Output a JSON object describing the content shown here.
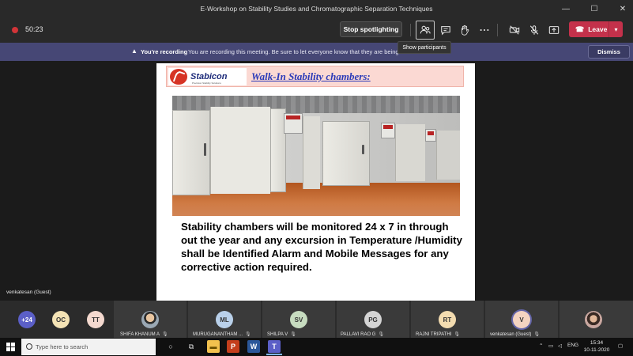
{
  "window": {
    "title": "E-Workshop on Stability Studies and Chromatographic Separation Techniques",
    "controls": [
      "—",
      "☐",
      "✕"
    ]
  },
  "toolbar": {
    "timer": "50:23",
    "spotlight_label": "Stop spotlighting",
    "leave_label": "Leave",
    "tooltip": "Show participants",
    "icons": [
      "participants-icon",
      "chat-icon",
      "raise-hand-icon",
      "more-icon",
      "camera-off-icon",
      "mic-off-icon",
      "share-icon"
    ]
  },
  "banner": {
    "title": "You're recording",
    "message": "You are recording this meeting. Be sure to let everyone know that they are being re",
    "dismiss_label": "Dismiss"
  },
  "slide": {
    "logo_text": "Stabicon",
    "logo_sub": "Precision Stability Solutions",
    "title": "Walk-In Stability chambers:",
    "body": "Stability chambers will be monitored 24 x 7 in through out the year and any excursion in Temperature /Humidity shall be Identified Alarm and Mobile Messages for any corrective action required."
  },
  "presenter_name": "venkatesan (Guest)",
  "participants": [
    {
      "initials": "+24",
      "color": "#5b5fc7",
      "text_color": "#ffffff"
    },
    {
      "initials": "OC",
      "color": "#f4e3b5"
    },
    {
      "initials": "TT",
      "color": "#f4d9cf"
    },
    {
      "initials": "",
      "name": "SHIFA KHANUM A",
      "photo": true
    },
    {
      "initials": "ML",
      "name": "MURUGANANTHAM ...",
      "color": "#b9d0ea"
    },
    {
      "initials": "SV",
      "name": "SHILPA V",
      "color": "#c7dcc0"
    },
    {
      "initials": "PG",
      "name": "PALLAVI RAO G",
      "color": "#d4d4d4"
    },
    {
      "initials": "RT",
      "name": "RAJNI TRIPATHI",
      "color": "#f3dcb0"
    },
    {
      "initials": "V",
      "name": "venkatesan (Guest)",
      "color": "#f4d4c1"
    },
    {
      "initials": "",
      "photo": true
    }
  ],
  "taskbar": {
    "search_placeholder": "Type here to search",
    "language": "ENG",
    "time": "15:34",
    "date": "10-11-2020"
  }
}
